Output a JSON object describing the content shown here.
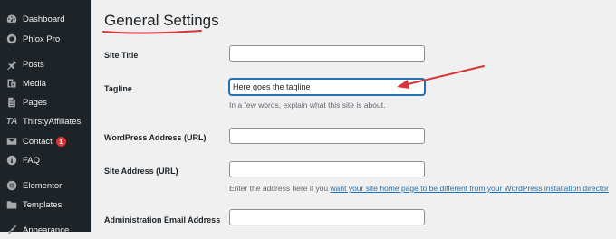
{
  "sidebar": {
    "items": [
      {
        "label": "Dashboard",
        "icon": "dashboard-icon"
      },
      {
        "label": "Phlox Pro",
        "icon": "gear-icon"
      },
      {
        "label": "Posts",
        "icon": "pin-icon"
      },
      {
        "label": "Media",
        "icon": "media-icon"
      },
      {
        "label": "Pages",
        "icon": "pages-icon"
      },
      {
        "label": "ThirstyAffiliates",
        "icon": "ta-icon"
      },
      {
        "label": "Contact",
        "icon": "mail-icon",
        "badge": "1"
      },
      {
        "label": "FAQ",
        "icon": "info-icon"
      },
      {
        "label": "Elementor",
        "icon": "elementor-icon"
      },
      {
        "label": "Templates",
        "icon": "folder-icon"
      },
      {
        "label": "Appearance",
        "icon": "brush-icon"
      }
    ]
  },
  "main": {
    "title": "General Settings",
    "fields": {
      "site_title": {
        "label": "Site Title",
        "value": ""
      },
      "tagline": {
        "label": "Tagline",
        "value": "Here goes the tagline",
        "description": "In a few words, explain what this site is about."
      },
      "wp_address": {
        "label": "WordPress Address (URL)",
        "value": ""
      },
      "site_address": {
        "label": "Site Address (URL)",
        "value": "",
        "description_prefix": "Enter the address here if you ",
        "description_link": "want your site home page to be different from your WordPress installation director"
      },
      "admin_email": {
        "label": "Administration Email Address",
        "value": ""
      }
    }
  },
  "colors": {
    "sidebar_bg": "#1d2327",
    "page_bg": "#f0f0f1",
    "link": "#2271b1",
    "annotation": "#d63638",
    "badge": "#d63638"
  }
}
